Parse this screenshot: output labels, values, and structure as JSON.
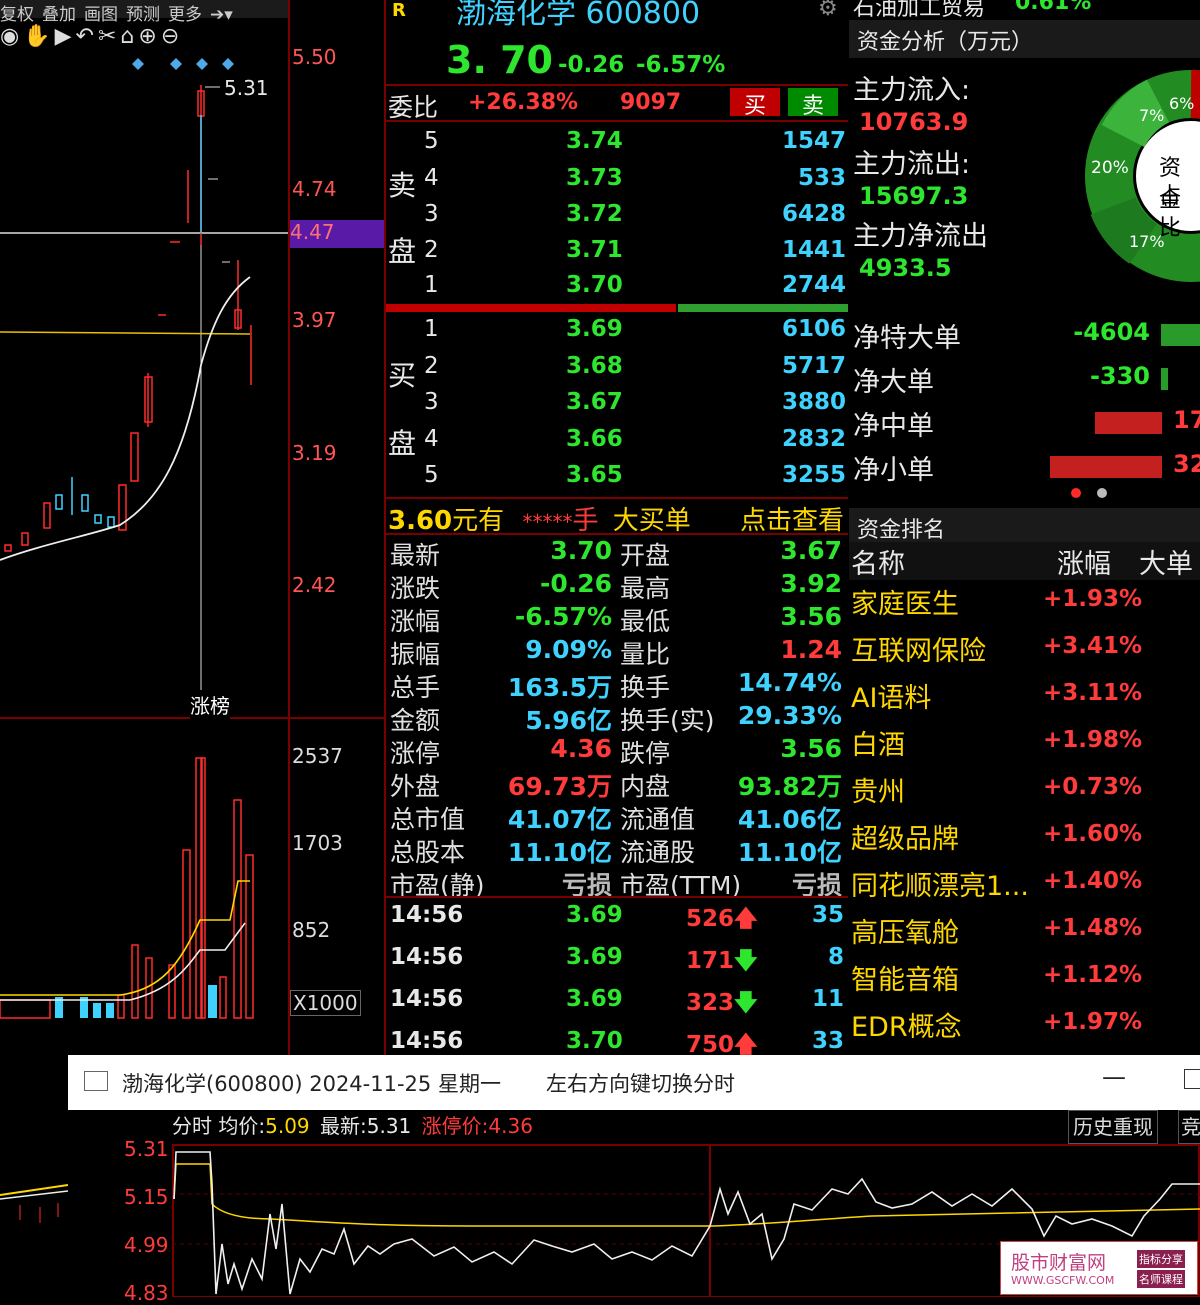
{
  "toolbar": {
    "items": [
      "复权",
      "叠加",
      "画图",
      "预测",
      "更多"
    ],
    "icons": [
      "eye-icon",
      "hand-icon",
      "play-icon",
      "undo-icon",
      "scissors-icon",
      "lock-icon",
      "zoom-in-icon",
      "zoom-out-icon"
    ]
  },
  "kline": {
    "peak_label": "5.31",
    "price_axis": [
      "5.50",
      "4.74",
      "4.47",
      "3.97",
      "3.19",
      "2.42"
    ],
    "tag": "涨榜",
    "vol_axis": [
      "2537",
      "1703",
      "852",
      "X1000"
    ]
  },
  "header": {
    "badge": "R",
    "stock": "渤海化学 600800",
    "price": "3. 70",
    "change": "-0.26",
    "change_pct": "-6.57%",
    "weibi_label": "委比",
    "weibi_pct": "+26.38%",
    "weibi_diff": "9097",
    "buy_btn": "买",
    "sell_btn": "卖"
  },
  "sell_side_label": [
    "卖",
    "盘"
  ],
  "buy_side_label": [
    "买",
    "盘"
  ],
  "sell_levels": [
    {
      "lvl": "5",
      "price": "3.74",
      "vol": "1547"
    },
    {
      "lvl": "4",
      "price": "3.73",
      "vol": "533"
    },
    {
      "lvl": "3",
      "price": "3.72",
      "vol": "6428"
    },
    {
      "lvl": "2",
      "price": "3.71",
      "vol": "1441"
    },
    {
      "lvl": "1",
      "price": "3.70",
      "vol": "2744"
    }
  ],
  "buy_levels": [
    {
      "lvl": "1",
      "price": "3.69",
      "vol": "6106"
    },
    {
      "lvl": "2",
      "price": "3.68",
      "vol": "5717"
    },
    {
      "lvl": "3",
      "price": "3.67",
      "vol": "3880"
    },
    {
      "lvl": "4",
      "price": "3.66",
      "vol": "2832"
    },
    {
      "lvl": "5",
      "price": "3.65",
      "vol": "3255"
    }
  ],
  "big_order": {
    "price": "3.60",
    "unit": "元有",
    "stars": "*****",
    "hand": "手",
    "label": "大买单",
    "link": "点击查看"
  },
  "quote": [
    {
      "k1": "最新",
      "v1": "3.70",
      "c1": "green",
      "k2": "开盘",
      "v2": "3.67",
      "c2": "green"
    },
    {
      "k1": "涨跌",
      "v1": "-0.26",
      "c1": "green",
      "k2": "最高",
      "v2": "3.92",
      "c2": "green"
    },
    {
      "k1": "涨幅",
      "v1": "-6.57%",
      "c1": "green",
      "k2": "最低",
      "v2": "3.56",
      "c2": "green"
    },
    {
      "k1": "振幅",
      "v1": "9.09%",
      "c1": "cyan",
      "k2": "量比",
      "v2": "1.24",
      "c2": "red"
    },
    {
      "k1": "总手",
      "v1": "163.5万",
      "c1": "cyan",
      "k2": "换手",
      "v2": "14.74%",
      "c2": "cyan"
    },
    {
      "k1": "金额",
      "v1": "5.96亿",
      "c1": "cyan",
      "k2": "换手(实)",
      "v2": "29.33%",
      "c2": "cyan"
    },
    {
      "k1": "涨停",
      "v1": "4.36",
      "c1": "red",
      "k2": "跌停",
      "v2": "3.56",
      "c2": "green"
    },
    {
      "k1": "外盘",
      "v1": "69.73万",
      "c1": "red",
      "k2": "内盘",
      "v2": "93.82万",
      "c2": "green"
    },
    {
      "k1": "总市值",
      "v1": "41.07亿",
      "c1": "cyan",
      "k2": "流通值",
      "v2": "41.06亿",
      "c2": "cyan"
    },
    {
      "k1": "总股本",
      "v1": "11.10亿",
      "c1": "cyan",
      "k2": "流通股",
      "v2": "11.10亿",
      "c2": "cyan"
    },
    {
      "k1": "市盈(静)",
      "v1": "亏损",
      "c1": "grey",
      "k2": "市盈(TTM)",
      "v2": "亏损",
      "c2": "grey"
    }
  ],
  "ticks": [
    {
      "time": "14:56",
      "price": "3.69",
      "vol": "526",
      "dir": "up",
      "num": "35"
    },
    {
      "time": "14:56",
      "price": "3.69",
      "vol": "171",
      "dir": "down",
      "num": "8"
    },
    {
      "time": "14:56",
      "price": "3.69",
      "vol": "323",
      "dir": "down",
      "num": "11"
    },
    {
      "time": "14:56",
      "price": "3.70",
      "vol": "750",
      "dir": "up",
      "num": "33"
    }
  ],
  "fund": {
    "top_label": "石油加工贸易",
    "top_value": "0.61%",
    "title": "资金分析（万元）",
    "inflow_label": "主力流入:",
    "inflow": "10763.9",
    "outflow_label": "主力流出:",
    "outflow": "15697.3",
    "net_label": "主力净流出",
    "net": "4933.5",
    "donut_pcts": [
      "7%",
      "6%",
      "20%",
      "17%"
    ],
    "donut_center": [
      "资金",
      "占比"
    ],
    "net_rows": [
      {
        "label": "净特大单",
        "value": "-4604",
        "color": "green",
        "bar": 0.4
      },
      {
        "label": "净大单",
        "value": "-330",
        "color": "green",
        "bar": 0.07
      },
      {
        "label": "净中单",
        "value": "17",
        "color": "red",
        "bar": 0.6
      },
      {
        "label": "净小单",
        "value": "32",
        "color": "red",
        "bar": 1.0
      }
    ]
  },
  "rank": {
    "title": "资金排名",
    "col_name": "名称",
    "col_pct": "涨幅",
    "col_big": "大单",
    "rows": [
      {
        "name": "家庭医生",
        "pct": "+1.93%"
      },
      {
        "name": "互联网保险",
        "pct": "+3.41%"
      },
      {
        "name": "AI语料",
        "pct": "+3.11%"
      },
      {
        "name": "白酒",
        "pct": "+1.98%"
      },
      {
        "name": "贵州",
        "pct": "+0.73%"
      },
      {
        "name": "超级品牌",
        "pct": "+1.60%"
      },
      {
        "name": "同花顺漂亮1...",
        "pct": "+1.40%"
      },
      {
        "name": "高压氧舱",
        "pct": "+1.48%"
      },
      {
        "name": "智能音箱",
        "pct": "+1.12%"
      },
      {
        "name": "EDR概念",
        "pct": "+1.97%"
      }
    ]
  },
  "popup": {
    "title": "渤海化学(600800) 2024-11-25 星期一",
    "hint": "左右方向键切换分时",
    "info_label": "分时",
    "avg_label": "均价:",
    "avg": "5.09",
    "last_label": "最新:",
    "last": "5.31",
    "limit_label": "涨停价:",
    "limit": "4.36",
    "btn_history": "历史重现",
    "btn_more": "竞",
    "axis": [
      "5.31",
      "5.15",
      "4.99",
      "4.83"
    ]
  },
  "watermark": {
    "cn": "股市财富网",
    "en": "WWW.GSCFW.COM",
    "tag1": "指标分享",
    "tag2": "名师课程"
  }
}
